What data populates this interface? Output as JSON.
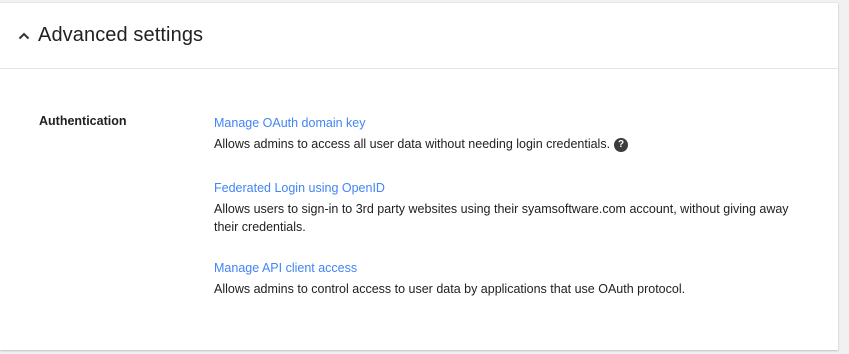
{
  "header": {
    "title": "Advanced settings",
    "collapse_icon": "chevron-up-icon"
  },
  "authentication": {
    "label": "Authentication",
    "items": [
      {
        "link": "Manage OAuth domain key",
        "description": "Allows admins to access all user data without needing login credentials.",
        "help_icon": "help-circle-icon"
      },
      {
        "link": "Federated Login using OpenID",
        "description": "Allows users to sign-in to 3rd party websites using their syamsoftware.com account, without giving away their credentials."
      },
      {
        "link": "Manage API client access",
        "description": "Allows admins to control access to user data by applications that use OAuth protocol."
      }
    ]
  },
  "colors": {
    "link": "#4285f4",
    "text": "#212121",
    "background": "#f1f1f1",
    "card": "#ffffff"
  }
}
